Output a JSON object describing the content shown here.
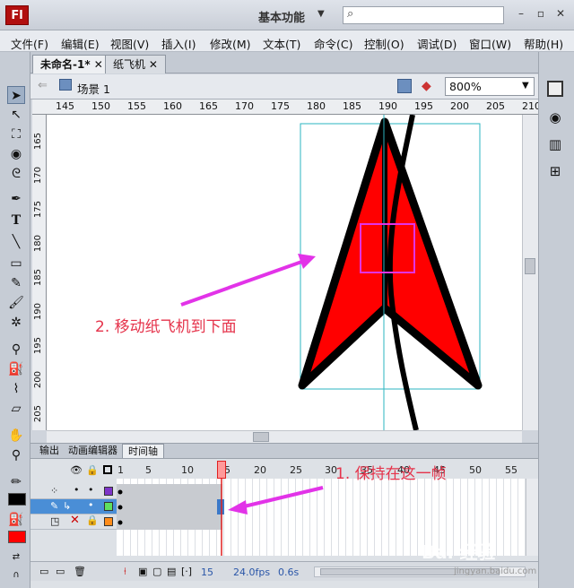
{
  "titlebar": {
    "logo": "Fl",
    "workspace": "基本功能",
    "search_placeholder": ""
  },
  "menu": [
    "文件(F)",
    "编辑(E)",
    "视图(V)",
    "插入(I)",
    "修改(M)",
    "文本(T)",
    "命令(C)",
    "控制(O)",
    "调试(D)",
    "窗口(W)",
    "帮助(H)"
  ],
  "tabs": [
    {
      "label": "未命名-1*"
    },
    {
      "label": "纸飞机"
    }
  ],
  "scene": {
    "label": "场景 1",
    "zoom": "800%"
  },
  "ruler": {
    "h": [
      "145",
      "150",
      "155",
      "160",
      "165",
      "170",
      "175",
      "180",
      "185",
      "190",
      "195",
      "200",
      "205",
      "210"
    ],
    "v": [
      "165",
      "170",
      "175",
      "180",
      "185",
      "190",
      "195",
      "200",
      "205"
    ]
  },
  "annotations": {
    "step2": "2. 移动纸飞机到下面",
    "step1": "1. 保持在这一帧"
  },
  "panel_tabs": [
    "输出",
    "动画编辑器",
    "时间轴"
  ],
  "timeline": {
    "frame_numbers": [
      "1",
      "5",
      "10",
      "15",
      "20",
      "25",
      "30",
      "35",
      "40",
      "45",
      "50",
      "55"
    ],
    "current_frame": "15",
    "fps": "24.0",
    "fps_unit": "fps",
    "time": "0.6s"
  },
  "colors": {
    "stroke": "#000000",
    "fill": "#ff0000",
    "accent_pink": "#e233e8",
    "guide": "#2bb5c0",
    "playhead": "#e02020"
  },
  "watermark": {
    "text": "Bai 经验",
    "sub": "jingyan.baidu.com"
  }
}
